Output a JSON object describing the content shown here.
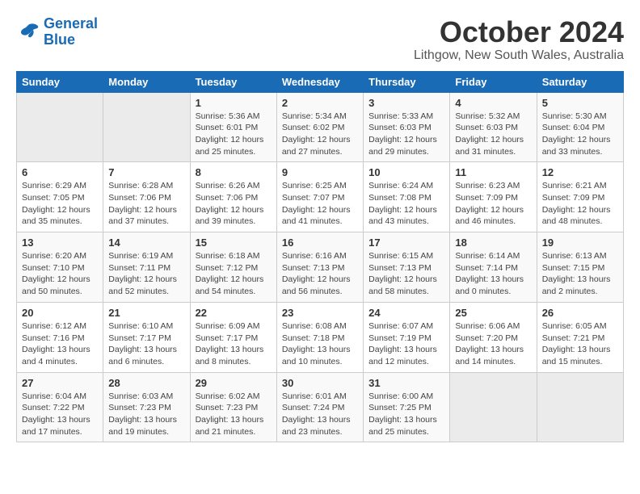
{
  "logo": {
    "line1": "General",
    "line2": "Blue"
  },
  "title": "October 2024",
  "subtitle": "Lithgow, New South Wales, Australia",
  "weekdays": [
    "Sunday",
    "Monday",
    "Tuesday",
    "Wednesday",
    "Thursday",
    "Friday",
    "Saturday"
  ],
  "weeks": [
    [
      {
        "num": "",
        "detail": ""
      },
      {
        "num": "",
        "detail": ""
      },
      {
        "num": "1",
        "detail": "Sunrise: 5:36 AM\nSunset: 6:01 PM\nDaylight: 12 hours\nand 25 minutes."
      },
      {
        "num": "2",
        "detail": "Sunrise: 5:34 AM\nSunset: 6:02 PM\nDaylight: 12 hours\nand 27 minutes."
      },
      {
        "num": "3",
        "detail": "Sunrise: 5:33 AM\nSunset: 6:03 PM\nDaylight: 12 hours\nand 29 minutes."
      },
      {
        "num": "4",
        "detail": "Sunrise: 5:32 AM\nSunset: 6:03 PM\nDaylight: 12 hours\nand 31 minutes."
      },
      {
        "num": "5",
        "detail": "Sunrise: 5:30 AM\nSunset: 6:04 PM\nDaylight: 12 hours\nand 33 minutes."
      }
    ],
    [
      {
        "num": "6",
        "detail": "Sunrise: 6:29 AM\nSunset: 7:05 PM\nDaylight: 12 hours\nand 35 minutes."
      },
      {
        "num": "7",
        "detail": "Sunrise: 6:28 AM\nSunset: 7:06 PM\nDaylight: 12 hours\nand 37 minutes."
      },
      {
        "num": "8",
        "detail": "Sunrise: 6:26 AM\nSunset: 7:06 PM\nDaylight: 12 hours\nand 39 minutes."
      },
      {
        "num": "9",
        "detail": "Sunrise: 6:25 AM\nSunset: 7:07 PM\nDaylight: 12 hours\nand 41 minutes."
      },
      {
        "num": "10",
        "detail": "Sunrise: 6:24 AM\nSunset: 7:08 PM\nDaylight: 12 hours\nand 43 minutes."
      },
      {
        "num": "11",
        "detail": "Sunrise: 6:23 AM\nSunset: 7:09 PM\nDaylight: 12 hours\nand 46 minutes."
      },
      {
        "num": "12",
        "detail": "Sunrise: 6:21 AM\nSunset: 7:09 PM\nDaylight: 12 hours\nand 48 minutes."
      }
    ],
    [
      {
        "num": "13",
        "detail": "Sunrise: 6:20 AM\nSunset: 7:10 PM\nDaylight: 12 hours\nand 50 minutes."
      },
      {
        "num": "14",
        "detail": "Sunrise: 6:19 AM\nSunset: 7:11 PM\nDaylight: 12 hours\nand 52 minutes."
      },
      {
        "num": "15",
        "detail": "Sunrise: 6:18 AM\nSunset: 7:12 PM\nDaylight: 12 hours\nand 54 minutes."
      },
      {
        "num": "16",
        "detail": "Sunrise: 6:16 AM\nSunset: 7:13 PM\nDaylight: 12 hours\nand 56 minutes."
      },
      {
        "num": "17",
        "detail": "Sunrise: 6:15 AM\nSunset: 7:13 PM\nDaylight: 12 hours\nand 58 minutes."
      },
      {
        "num": "18",
        "detail": "Sunrise: 6:14 AM\nSunset: 7:14 PM\nDaylight: 13 hours\nand 0 minutes."
      },
      {
        "num": "19",
        "detail": "Sunrise: 6:13 AM\nSunset: 7:15 PM\nDaylight: 13 hours\nand 2 minutes."
      }
    ],
    [
      {
        "num": "20",
        "detail": "Sunrise: 6:12 AM\nSunset: 7:16 PM\nDaylight: 13 hours\nand 4 minutes."
      },
      {
        "num": "21",
        "detail": "Sunrise: 6:10 AM\nSunset: 7:17 PM\nDaylight: 13 hours\nand 6 minutes."
      },
      {
        "num": "22",
        "detail": "Sunrise: 6:09 AM\nSunset: 7:17 PM\nDaylight: 13 hours\nand 8 minutes."
      },
      {
        "num": "23",
        "detail": "Sunrise: 6:08 AM\nSunset: 7:18 PM\nDaylight: 13 hours\nand 10 minutes."
      },
      {
        "num": "24",
        "detail": "Sunrise: 6:07 AM\nSunset: 7:19 PM\nDaylight: 13 hours\nand 12 minutes."
      },
      {
        "num": "25",
        "detail": "Sunrise: 6:06 AM\nSunset: 7:20 PM\nDaylight: 13 hours\nand 14 minutes."
      },
      {
        "num": "26",
        "detail": "Sunrise: 6:05 AM\nSunset: 7:21 PM\nDaylight: 13 hours\nand 15 minutes."
      }
    ],
    [
      {
        "num": "27",
        "detail": "Sunrise: 6:04 AM\nSunset: 7:22 PM\nDaylight: 13 hours\nand 17 minutes."
      },
      {
        "num": "28",
        "detail": "Sunrise: 6:03 AM\nSunset: 7:23 PM\nDaylight: 13 hours\nand 19 minutes."
      },
      {
        "num": "29",
        "detail": "Sunrise: 6:02 AM\nSunset: 7:23 PM\nDaylight: 13 hours\nand 21 minutes."
      },
      {
        "num": "30",
        "detail": "Sunrise: 6:01 AM\nSunset: 7:24 PM\nDaylight: 13 hours\nand 23 minutes."
      },
      {
        "num": "31",
        "detail": "Sunrise: 6:00 AM\nSunset: 7:25 PM\nDaylight: 13 hours\nand 25 minutes."
      },
      {
        "num": "",
        "detail": ""
      },
      {
        "num": "",
        "detail": ""
      }
    ]
  ]
}
